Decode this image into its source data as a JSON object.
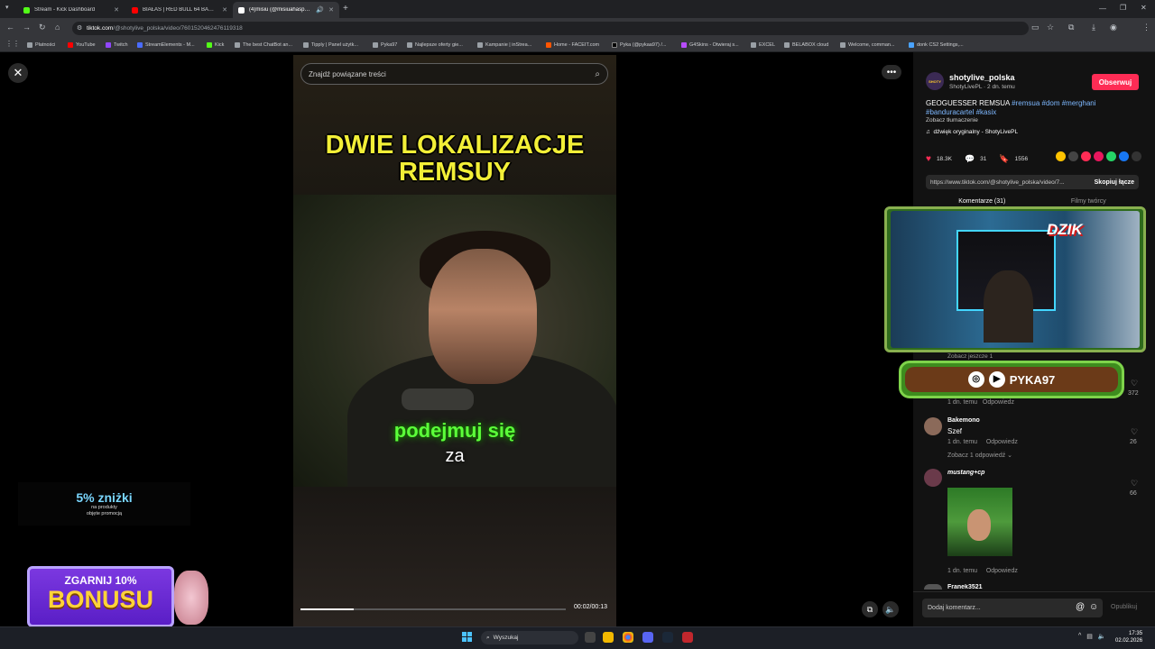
{
  "browser": {
    "tabs": [
      {
        "title": "Stream - Kick Dashboard",
        "color": "#53fc18"
      },
      {
        "title": "BIAŁAS | RED BULL 64 BARS - Y",
        "color": "#ff0000"
      },
      {
        "title": "(4)misiu (@misiuahaspoko) ",
        "color": "#ffffff"
      }
    ],
    "new_tab": "+",
    "url_host": "tiktok.com",
    "url_path": "/@shotylive_polska/video/7601520462476119318",
    "bookmarks": [
      "Płatności",
      "YouTube",
      "Twitch",
      "StreamElements - M...",
      "Kick",
      "The best ChatBot an...",
      "Tipply | Panel użytk...",
      "Pyka97",
      "Najlepsze oferty gie...",
      "Kampanie | inStrea...",
      "Home - FACEIT.com",
      "Pyka (@pykaa97) /...",
      "G4Skins - Otwieraj s...",
      "EXCEL",
      "BELABOX cloud",
      "Welcome, comman...",
      "donk CS2 Settings,..."
    ]
  },
  "video": {
    "search_placeholder": "Znajdź powiązane treści",
    "title_line1": "DWIE LOKALIZACJE",
    "title_line2": "REMSUY",
    "caption1": "podejmuj się",
    "caption2": "za",
    "progress": 0.2,
    "time": "00:02/00:13"
  },
  "promo": {
    "big": "5% zniżki",
    "small1": "na produkty",
    "small2": "objęte promocją"
  },
  "bonus": {
    "line1": "ZGARNIJ 10%",
    "line2": "BONUSU"
  },
  "post": {
    "avatar_text": "SHOTY",
    "username": "shotylive_polska",
    "sub": "ShotyLivePL · 2 dn. temu",
    "follow": "Obserwuj",
    "desc_text": "GEOGUESSER REMSUA ",
    "tags1": "#remsua #dom #merghani",
    "tags2": "#banduracartel #kasix",
    "translate": "Zobacz tłumaczenie",
    "sound": "dźwięk oryginalny - ShotyLivePL",
    "likes": "18.3K",
    "comments": "31",
    "saves": "1556",
    "link": "https://www.tiktok.com/@shotylive_polska/video/7...",
    "copy": "Skopiuj łącze",
    "tab_comments": "Komentarze (31)",
    "tab_creator": "Filmy twórcy"
  },
  "overlay": {
    "dzik": "DZIK",
    "channel": "PYKA97"
  },
  "comments": [
    {
      "hidden_reply": "Zobacz jeszcze 1",
      "likes": "372",
      "meta": "1 dn. temu",
      "reply": "Odpowiedz"
    },
    {
      "user": "Bakemono",
      "text": "Szef",
      "meta": "1 dn. temu",
      "reply": "Odpowiedz",
      "likes": "26",
      "more": "Zobacz 1 odpowiedź"
    },
    {
      "user": "mustang+cp",
      "meta": "1 dn. temu",
      "reply": "Odpowiedz",
      "likes": "66"
    },
    {
      "user": "Franek3521"
    }
  ],
  "comment_box": {
    "placeholder": "Dodaj komentarz...",
    "publish": "Opublikuj"
  },
  "taskbar": {
    "search": "Wyszukaj",
    "time": "17:35",
    "date": "02.02.2026"
  }
}
